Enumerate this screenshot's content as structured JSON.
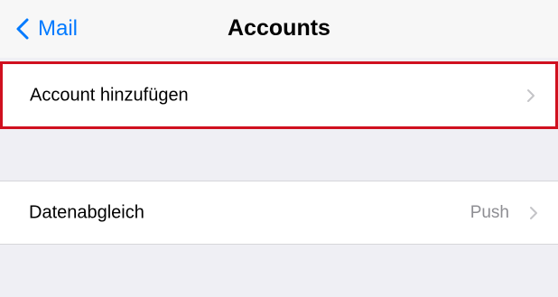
{
  "nav": {
    "back_label": "Mail",
    "title": "Accounts"
  },
  "cells": {
    "add_account": {
      "label": "Account hinzufügen"
    },
    "data_sync": {
      "label": "Datenabgleich",
      "value": "Push"
    }
  },
  "icons": {
    "back": "chevron-left-icon",
    "disclosure": "chevron-right-icon"
  },
  "colors": {
    "accent": "#007aff",
    "highlight_border": "#d0101f",
    "secondary_text": "#8e8e93",
    "grouped_background": "#efeff4"
  }
}
